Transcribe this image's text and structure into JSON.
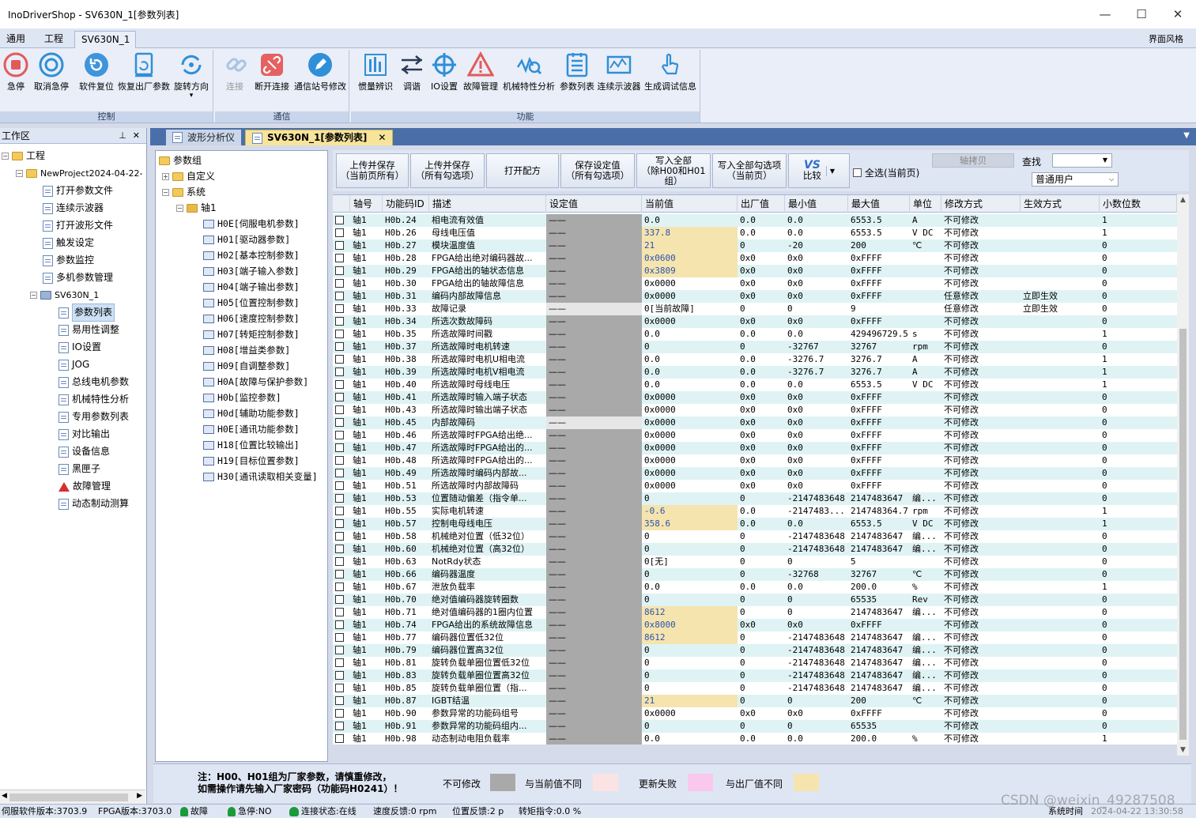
{
  "window": {
    "title": "InoDriverShop - SV630N_1[参数列表]"
  },
  "menu": {
    "tabs": [
      "通用",
      "工程",
      "SV630N_1"
    ],
    "skin": "界面风格"
  },
  "ribbon": {
    "groups": [
      "控制",
      "通信",
      "功能"
    ],
    "buttons": [
      "急停",
      "取消急停",
      "软件复位",
      "恢复出厂参数",
      "旋转方向",
      "连接",
      "断开连接",
      "通信站号修改",
      "惯量辨识",
      "调谐",
      "IO设置",
      "故障管理",
      "机械特性分析",
      "参数列表",
      "连续示波器",
      "生成调试信息"
    ]
  },
  "workspace": {
    "title": "工作区",
    "items": [
      "工程",
      "NewProject2024-04-22-",
      "打开参数文件",
      "连续示波器",
      "打开波形文件",
      "触发设定",
      "参数监控",
      "多机参数管理",
      "SV630N_1",
      "参数列表",
      "易用性调整",
      "IO设置",
      "JOG",
      "总线电机参数",
      "机械特性分析",
      "专用参数列表",
      "对比输出",
      "设备信息",
      "黑匣子",
      "故障管理",
      "动态制动测算"
    ]
  },
  "doctabs": [
    "波形分析仪",
    "SV630N_1[参数列表]"
  ],
  "ptree": {
    "root": "参数组",
    "custom": "自定义",
    "system": "系统",
    "axis": "轴1",
    "groups": [
      "H0E[伺服电机参数]",
      "H01[驱动器参数]",
      "H02[基本控制参数]",
      "H03[端子输入参数]",
      "H04[端子输出参数]",
      "H05[位置控制参数]",
      "H06[速度控制参数]",
      "H07[转矩控制参数]",
      "H08[增益类参数]",
      "H09[自调整参数]",
      "H0A[故障与保护参数]",
      "H0b[监控参数]",
      "H0d[辅助功能参数]",
      "H0E[通讯功能参数]",
      "H18[位置比较输出]",
      "H19[目标位置参数]",
      "H30[通讯读取相关变量]"
    ]
  },
  "toolbar": {
    "upload_current": [
      "上传并保存",
      "（当前页所有）"
    ],
    "upload_checked": [
      "上传并保存",
      "（所有勾选项）"
    ],
    "open_recipe": "打开配方",
    "save_setting": [
      "保存设定值",
      "（所有勾选项）"
    ],
    "write_all": [
      "写入全部",
      "（除H00和H01组）"
    ],
    "write_checked": [
      "写入全部勾选项",
      "（当前页）"
    ],
    "compare": "比较",
    "select_all": "全选(当前页)",
    "axis_copy": "轴拷贝",
    "search_label": "查找",
    "search_value": "",
    "user_level": "普通用户"
  },
  "table": {
    "columns": [
      "",
      "轴号",
      "功能码ID",
      "描述",
      "设定值",
      "当前值",
      "出厂值",
      "最小值",
      "最大值",
      "单位",
      "修改方式",
      "生效方式",
      "小数位数"
    ],
    "rows": [
      [
        "轴1",
        "H0b.24",
        "相电流有效值",
        "——",
        "0.0",
        "0.0",
        "0.0",
        "6553.5",
        "A",
        "不可修改",
        "",
        "1"
      ],
      [
        "轴1",
        "H0b.26",
        "母线电压值",
        "——",
        "337.8",
        "0.0",
        "0.0",
        "6553.5",
        "V DC",
        "不可修改",
        "",
        "1"
      ],
      [
        "轴1",
        "H0b.27",
        "模块温度值",
        "——",
        "21",
        "0",
        "-20",
        "200",
        "℃",
        "不可修改",
        "",
        "0"
      ],
      [
        "轴1",
        "H0b.28",
        "FPGA给出绝对编码器故...",
        "——",
        "0x0600",
        "0x0",
        "0x0",
        "0xFFFF",
        "",
        "不可修改",
        "",
        "0"
      ],
      [
        "轴1",
        "H0b.29",
        "FPGA给出的轴状态信息",
        "——",
        "0x3809",
        "0x0",
        "0x0",
        "0xFFFF",
        "",
        "不可修改",
        "",
        "0"
      ],
      [
        "轴1",
        "H0b.30",
        "FPGA给出的轴故障信息",
        "——",
        "0x0000",
        "0x0",
        "0x0",
        "0xFFFF",
        "",
        "不可修改",
        "",
        "0"
      ],
      [
        "轴1",
        "H0b.31",
        "编码内部故障信息",
        "——",
        "0x0000",
        "0x0",
        "0x0",
        "0xFFFF",
        "",
        "任意修改",
        "立即生效",
        "0"
      ],
      [
        "轴1",
        "H0b.33",
        "故障记录",
        "——",
        "0[当前故障]",
        "0",
        "0",
        "9",
        "",
        "任意修改",
        "立即生效",
        "0"
      ],
      [
        "轴1",
        "H0b.34",
        "所选次数故障码",
        "——",
        "0x0000",
        "0x0",
        "0x0",
        "0xFFFF",
        "",
        "不可修改",
        "",
        "0"
      ],
      [
        "轴1",
        "H0b.35",
        "所选故障时间戳",
        "——",
        "0.0",
        "0.0",
        "0.0",
        "429496729.5",
        "s",
        "不可修改",
        "",
        "1"
      ],
      [
        "轴1",
        "H0b.37",
        "所选故障时电机转速",
        "——",
        "0",
        "0",
        "-32767",
        "32767",
        "rpm",
        "不可修改",
        "",
        "0"
      ],
      [
        "轴1",
        "H0b.38",
        "所选故障时电机U相电流",
        "——",
        "0.0",
        "0.0",
        "-3276.7",
        "3276.7",
        "A",
        "不可修改",
        "",
        "1"
      ],
      [
        "轴1",
        "H0b.39",
        "所选故障时电机V相电流",
        "——",
        "0.0",
        "0.0",
        "-3276.7",
        "3276.7",
        "A",
        "不可修改",
        "",
        "1"
      ],
      [
        "轴1",
        "H0b.40",
        "所选故障时母线电压",
        "——",
        "0.0",
        "0.0",
        "0.0",
        "6553.5",
        "V DC",
        "不可修改",
        "",
        "1"
      ],
      [
        "轴1",
        "H0b.41",
        "所选故障时输入端子状态",
        "——",
        "0x0000",
        "0x0",
        "0x0",
        "0xFFFF",
        "",
        "不可修改",
        "",
        "0"
      ],
      [
        "轴1",
        "H0b.43",
        "所选故障时输出端子状态",
        "——",
        "0x0000",
        "0x0",
        "0x0",
        "0xFFFF",
        "",
        "不可修改",
        "",
        "0"
      ],
      [
        "轴1",
        "H0b.45",
        "内部故障码",
        "——",
        "0x0000",
        "0x0",
        "0x0",
        "0xFFFF",
        "",
        "不可修改",
        "",
        "0"
      ],
      [
        "轴1",
        "H0b.46",
        "所选故障时FPGA给出绝...",
        "——",
        "0x0000",
        "0x0",
        "0x0",
        "0xFFFF",
        "",
        "不可修改",
        "",
        "0"
      ],
      [
        "轴1",
        "H0b.47",
        "所选故障时FPGA给出的...",
        "——",
        "0x0000",
        "0x0",
        "0x0",
        "0xFFFF",
        "",
        "不可修改",
        "",
        "0"
      ],
      [
        "轴1",
        "H0b.48",
        "所选故障时FPGA给出的...",
        "——",
        "0x0000",
        "0x0",
        "0x0",
        "0xFFFF",
        "",
        "不可修改",
        "",
        "0"
      ],
      [
        "轴1",
        "H0b.49",
        "所选故障时编码内部故...",
        "——",
        "0x0000",
        "0x0",
        "0x0",
        "0xFFFF",
        "",
        "不可修改",
        "",
        "0"
      ],
      [
        "轴1",
        "H0b.51",
        "所选故障时内部故障码",
        "——",
        "0x0000",
        "0x0",
        "0x0",
        "0xFFFF",
        "",
        "不可修改",
        "",
        "0"
      ],
      [
        "轴1",
        "H0b.53",
        "位置随动偏差（指令单...",
        "——",
        "0",
        "0",
        "-2147483648",
        "2147483647",
        "编...",
        "不可修改",
        "",
        "0"
      ],
      [
        "轴1",
        "H0b.55",
        "实际电机转速",
        "——",
        "-0.6",
        "0.0",
        "-2147483...",
        "214748364.7",
        "rpm",
        "不可修改",
        "",
        "1"
      ],
      [
        "轴1",
        "H0b.57",
        "控制电母线电压",
        "——",
        "358.6",
        "0.0",
        "0.0",
        "6553.5",
        "V DC",
        "不可修改",
        "",
        "1"
      ],
      [
        "轴1",
        "H0b.58",
        "机械绝对位置（低32位）",
        "——",
        "0",
        "0",
        "-2147483648",
        "2147483647",
        "编...",
        "不可修改",
        "",
        "0"
      ],
      [
        "轴1",
        "H0b.60",
        "机械绝对位置（高32位）",
        "——",
        "0",
        "0",
        "-2147483648",
        "2147483647",
        "编...",
        "不可修改",
        "",
        "0"
      ],
      [
        "轴1",
        "H0b.63",
        "NotRdy状态",
        "——",
        "0[无]",
        "0",
        "0",
        "5",
        "",
        "不可修改",
        "",
        "0"
      ],
      [
        "轴1",
        "H0b.66",
        "编码器温度",
        "——",
        "0",
        "0",
        "-32768",
        "32767",
        "℃",
        "不可修改",
        "",
        "0"
      ],
      [
        "轴1",
        "H0b.67",
        "泄放负载率",
        "——",
        "0.0",
        "0.0",
        "0.0",
        "200.0",
        "%",
        "不可修改",
        "",
        "1"
      ],
      [
        "轴1",
        "H0b.70",
        "绝对值编码器旋转圈数",
        "——",
        "0",
        "0",
        "0",
        "65535",
        "Rev",
        "不可修改",
        "",
        "0"
      ],
      [
        "轴1",
        "H0b.71",
        "绝对值编码器的1圈内位置",
        "——",
        "8612",
        "0",
        "0",
        "2147483647",
        "编...",
        "不可修改",
        "",
        "0"
      ],
      [
        "轴1",
        "H0b.74",
        "FPGA给出的系统故障信息",
        "——",
        "0x8000",
        "0x0",
        "0x0",
        "0xFFFF",
        "",
        "不可修改",
        "",
        "0"
      ],
      [
        "轴1",
        "H0b.77",
        "编码器位置低32位",
        "——",
        "8612",
        "0",
        "-2147483648",
        "2147483647",
        "编...",
        "不可修改",
        "",
        "0"
      ],
      [
        "轴1",
        "H0b.79",
        "编码器位置高32位",
        "——",
        "0",
        "0",
        "-2147483648",
        "2147483647",
        "编...",
        "不可修改",
        "",
        "0"
      ],
      [
        "轴1",
        "H0b.81",
        "旋转负载单圈位置低32位",
        "——",
        "0",
        "0",
        "-2147483648",
        "2147483647",
        "编...",
        "不可修改",
        "",
        "0"
      ],
      [
        "轴1",
        "H0b.83",
        "旋转负载单圈位置高32位",
        "——",
        "0",
        "0",
        "-2147483648",
        "2147483647",
        "编...",
        "不可修改",
        "",
        "0"
      ],
      [
        "轴1",
        "H0b.85",
        "旋转负载单圈位置（指...",
        "——",
        "0",
        "0",
        "-2147483648",
        "2147483647",
        "编...",
        "不可修改",
        "",
        "0"
      ],
      [
        "轴1",
        "H0b.87",
        "IGBT结温",
        "——",
        "21",
        "0",
        "0",
        "200",
        "℃",
        "不可修改",
        "",
        "0"
      ],
      [
        "轴1",
        "H0b.90",
        "参数异常的功能码组号",
        "——",
        "0x0000",
        "0x0",
        "0x0",
        "0xFFFF",
        "",
        "不可修改",
        "",
        "0"
      ],
      [
        "轴1",
        "H0b.91",
        "参数异常的功能码组内...",
        "——",
        "0",
        "0",
        "0",
        "65535",
        "",
        "不可修改",
        "",
        "0"
      ],
      [
        "轴1",
        "H0b.98",
        "动态制动电阻负载率",
        "——",
        "0.0",
        "0.0",
        "0.0",
        "200.0",
        "%",
        "不可修改",
        "",
        "1"
      ]
    ]
  },
  "legend": {
    "note": [
      "注：H00、H01组为厂家参数，请慎重修改，",
      "如需操作请先输入厂家密码（功能码H0241）！"
    ],
    "items": [
      {
        "label": "不可修改",
        "color": "#a9a9a9"
      },
      {
        "label": "与当前值不同",
        "color": "#fce3e3"
      },
      {
        "label": "更新失败",
        "color": "#f9c8ec"
      },
      {
        "label": "与出厂值不同",
        "color": "#f6e4ae"
      }
    ]
  },
  "status": {
    "servo_ver": "伺服软件版本:3703.9",
    "fpga_ver": "FPGA版本:3703.0",
    "fault": "故障",
    "estop": "急停:NO",
    "conn": "连接状态:在线",
    "speed": "速度反馈:0 rpm",
    "pos": "位置反馈:2 p",
    "torque": "转矩指令:0.0 %",
    "systime_label": "系统时间",
    "systime": "2024-04-22 13:30:58"
  },
  "watermark": "CSDN @weixin_49287508"
}
